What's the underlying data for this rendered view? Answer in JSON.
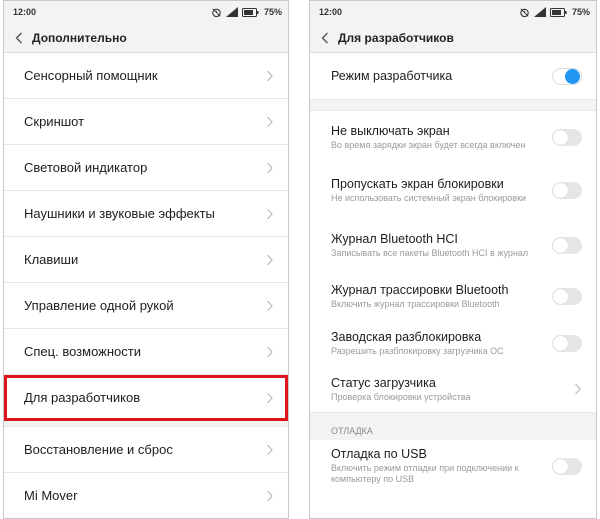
{
  "left": {
    "status": {
      "time": "12:00",
      "battery": "75%"
    },
    "header": {
      "title": "Дополнительно"
    },
    "items": [
      {
        "label": "Сенсорный помощник"
      },
      {
        "label": "Скриншот"
      },
      {
        "label": "Световой индикатор"
      },
      {
        "label": "Наушники и звуковые эффекты"
      },
      {
        "label": "Клавиши"
      },
      {
        "label": "Управление одной рукой"
      },
      {
        "label": "Спец. возможности"
      },
      {
        "label": "Для разработчиков",
        "highlighted": true
      },
      {
        "label": "Восстановление и сброс"
      },
      {
        "label": "Mi Mover"
      }
    ]
  },
  "right": {
    "status": {
      "time": "12:00",
      "battery": "75%"
    },
    "header": {
      "title": "Для разработчиков"
    },
    "dev_mode": {
      "label": "Режим разработчика",
      "enabled": true
    },
    "items": [
      {
        "title": "Не выключать экран",
        "subtitle": "Во время зарядки экран будет всегда включен",
        "enabled": false
      },
      {
        "title": "Пропускать экран блокировки",
        "subtitle": "Не использовать системный экран блокировки",
        "enabled": false
      },
      {
        "title": "Журнал Bluetooth HCI",
        "subtitle": "Записывать все пакеты Bluetooth HCI в журнал",
        "enabled": false
      },
      {
        "title": "Журнал трассировки Bluetooth",
        "subtitle": "Включить журнал трассировки Bluetooth",
        "enabled": false
      },
      {
        "title": "Заводская разблокировка",
        "subtitle": "Разрешить разблокировку загрузчика ОС",
        "enabled": false
      },
      {
        "title": "Статус загрузчика",
        "subtitle": "Проверка блокировки устройства"
      }
    ],
    "debug_section": {
      "header": "ОТЛАДКА",
      "usb": {
        "title": "Отладка по USB",
        "subtitle": "Включить режим отладки при подключении к компьютеру по USB",
        "enabled": false
      }
    }
  },
  "colors": {
    "highlight": "#e0141c",
    "accent": "#2196f3"
  },
  "icons": [
    "back-chevron-icon",
    "chevron-right-icon",
    "alarm-icon",
    "signal-icon",
    "battery-icon"
  ]
}
